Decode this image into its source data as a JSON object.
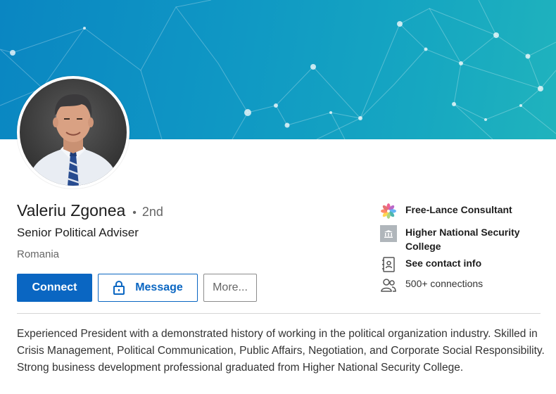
{
  "profile": {
    "name": "Valeriu Zgonea",
    "degree_separator": "•",
    "degree": "2nd",
    "headline": "Senior Political Adviser",
    "location": "Romania"
  },
  "actions": {
    "connect_label": "Connect",
    "message_label": "Message",
    "more_label": "More..."
  },
  "sidebar": {
    "current_company": "Free-Lance Consultant",
    "education": "Higher National Security College",
    "contact_label": "See contact info",
    "connections": "500+ connections"
  },
  "summary": "Experienced President with a demonstrated history of working in the political organization industry. Skilled in Crisis Management, Political Communication, Public Affairs, Negotiation, and Corporate Social Responsibility. Strong business development professional graduated from Higher National Security College.",
  "colors": {
    "brand_blue": "#0a66c2",
    "banner_start": "#0a86c2",
    "banner_end": "#20b3bd"
  },
  "icons": [
    "photo-flower-icon",
    "school-icon",
    "contact-card-icon",
    "people-icon",
    "lock-icon"
  ]
}
